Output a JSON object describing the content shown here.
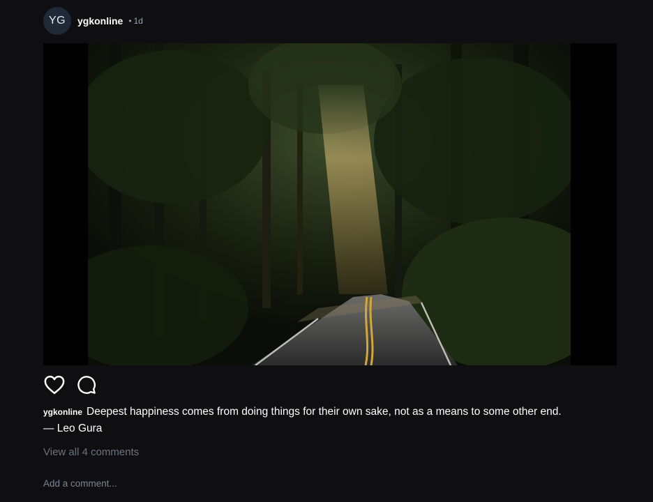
{
  "post": {
    "avatar_initials": "YG",
    "username": "ygkonline",
    "separator": "•",
    "time_ago": "1d",
    "image_icon": "forest-road-photo",
    "actions": {
      "like_icon": "heart-icon",
      "comment_icon": "comment-bubble-icon"
    },
    "caption": {
      "username": "ygkonline",
      "text": "Deepest happiness comes from doing things for their own sake, not as a means to some other end.",
      "author": "— Leo Gura"
    },
    "view_comments_label": "View all 4 comments",
    "add_comment_placeholder": "Add a comment..."
  },
  "colors": {
    "background": "#0f0f11",
    "avatar_bg": "#1f2937",
    "muted_text": "#6b7280"
  }
}
